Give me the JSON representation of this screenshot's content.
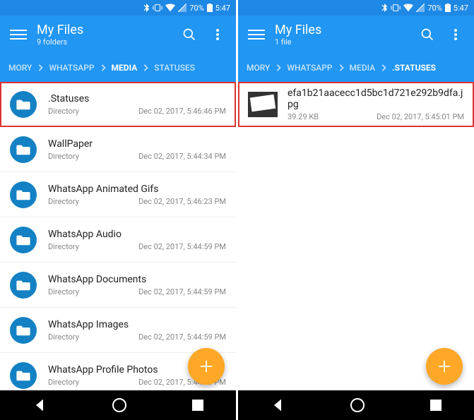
{
  "status": {
    "battery": "70%",
    "time": "5:47"
  },
  "left": {
    "title": "My Files",
    "subtitle": "9 folders",
    "breadcrumb": [
      "MORY",
      "WHATSAPP",
      "MEDIA",
      "STATUSES"
    ],
    "activeCrumbIndex": 2,
    "items": [
      {
        "name": ".Statuses",
        "type": "Directory",
        "date": "Dec 02, 2017, 5:46:46 PM",
        "highlight": true
      },
      {
        "name": "WallPaper",
        "type": "Directory",
        "date": "Dec 02, 2017, 5:44:34 PM"
      },
      {
        "name": "WhatsApp Animated Gifs",
        "type": "Directory",
        "date": "Dec 02, 2017, 5:46:23 PM"
      },
      {
        "name": "WhatsApp Audio",
        "type": "Directory",
        "date": "Dec 02, 2017, 5:44:59 PM"
      },
      {
        "name": "WhatsApp Documents",
        "type": "Directory",
        "date": "Dec 02, 2017, 5:44:59 PM"
      },
      {
        "name": "WhatsApp Images",
        "type": "Directory",
        "date": "Dec 02, 2017, 5:44:59 PM"
      },
      {
        "name": "WhatsApp Profile Photos",
        "type": "Directory",
        "date": "Dec 02, 2017, 5:44:59 PM"
      }
    ]
  },
  "right": {
    "title": "My Files",
    "subtitle": "1 file",
    "breadcrumb": [
      "MORY",
      "WHATSAPP",
      "MEDIA",
      ".STATUSES"
    ],
    "activeCrumbIndex": 3,
    "items": [
      {
        "name": "efa1b21aacecc1d5bc1d721e292b9dfa.jpg",
        "size": "39.29 KB",
        "date": "Dec 02, 2017, 5:45:01 PM",
        "highlight": true,
        "thumb": true
      }
    ]
  }
}
